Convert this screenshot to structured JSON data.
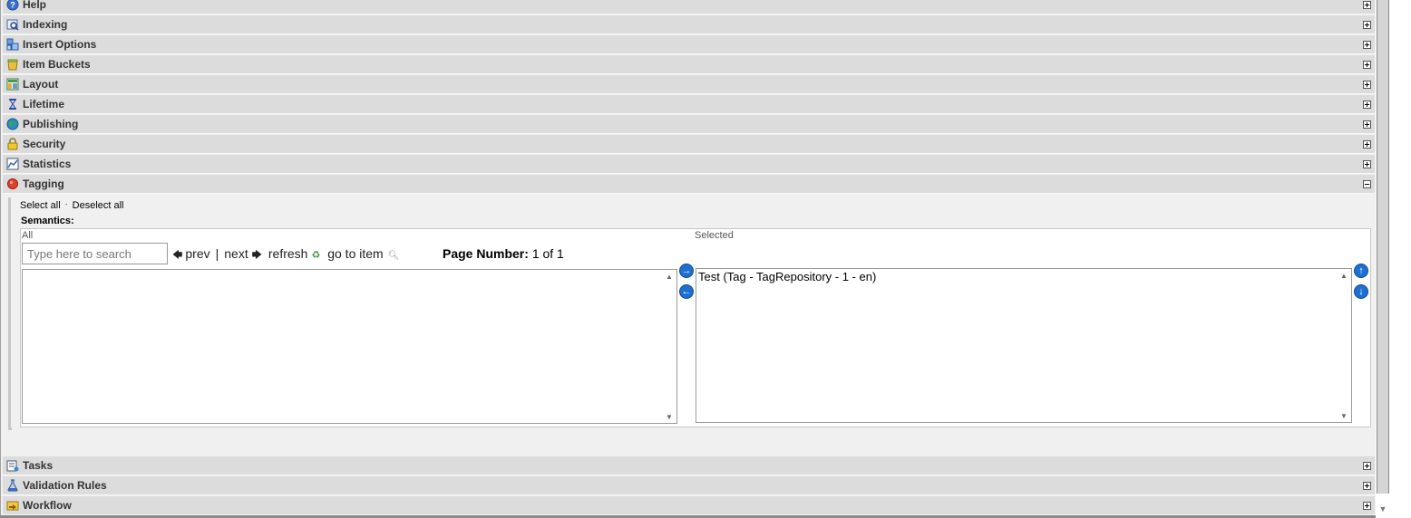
{
  "sections_top": [
    {
      "key": "help",
      "title": "Help",
      "icon": "help-icon",
      "state": "collapsed"
    },
    {
      "key": "indexing",
      "title": "Indexing",
      "icon": "indexing-icon",
      "state": "collapsed"
    },
    {
      "key": "insert-options",
      "title": "Insert Options",
      "icon": "insert-options-icon",
      "state": "collapsed"
    },
    {
      "key": "item-buckets",
      "title": "Item Buckets",
      "icon": "bucket-icon",
      "state": "collapsed"
    },
    {
      "key": "layout",
      "title": "Layout",
      "icon": "layout-icon",
      "state": "collapsed"
    },
    {
      "key": "lifetime",
      "title": "Lifetime",
      "icon": "hourglass-icon",
      "state": "collapsed"
    },
    {
      "key": "publishing",
      "title": "Publishing",
      "icon": "globe-icon",
      "state": "collapsed"
    },
    {
      "key": "security",
      "title": "Security",
      "icon": "lock-icon",
      "state": "collapsed"
    },
    {
      "key": "statistics",
      "title": "Statistics",
      "icon": "statistics-icon",
      "state": "collapsed"
    },
    {
      "key": "tagging",
      "title": "Tagging",
      "icon": "tag-dot-icon",
      "state": "expanded"
    }
  ],
  "sections_bottom": [
    {
      "key": "tasks",
      "title": "Tasks",
      "icon": "tasks-icon",
      "state": "collapsed"
    },
    {
      "key": "validation-rules",
      "title": "Validation Rules",
      "icon": "flask-icon",
      "state": "collapsed"
    },
    {
      "key": "workflow",
      "title": "Workflow",
      "icon": "workflow-icon",
      "state": "collapsed"
    }
  ],
  "tagging": {
    "select_all": "Select all",
    "separator": "·",
    "deselect_all": "Deselect all",
    "field_label": "Semantics:",
    "all_label": "All",
    "selected_label": "Selected",
    "search_placeholder": "Type here to search",
    "search_value": "",
    "prev": "prev",
    "divider": "|",
    "next": "next",
    "refresh": "refresh",
    "go_to_item": "go to item",
    "page_number_label": "Page Number:",
    "page_number_value": "1 of 1",
    "all_items": [],
    "selected_items": [
      "Test (Tag - TagRepository - 1 - en)"
    ]
  }
}
